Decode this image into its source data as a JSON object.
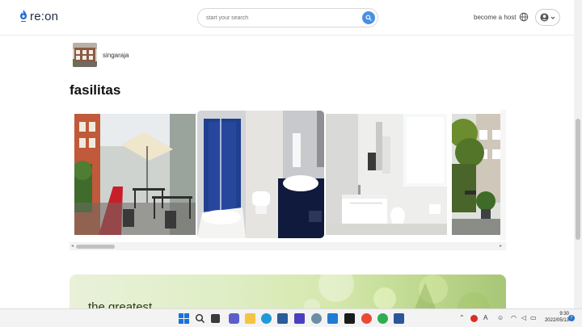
{
  "header": {
    "logo_text": "re:on",
    "search_placeholder": "start your search",
    "host_link": "become a host"
  },
  "location": {
    "name": "singaraja"
  },
  "section_title": "fasilitas",
  "banner": {
    "text": "the greatest"
  },
  "taskbar": {
    "time": "9:30",
    "date": "2022/05/13",
    "notification_count": "7",
    "ime_label": "A"
  },
  "colors": {
    "accent": "#4a90e2",
    "brand": "#1f2a44"
  }
}
